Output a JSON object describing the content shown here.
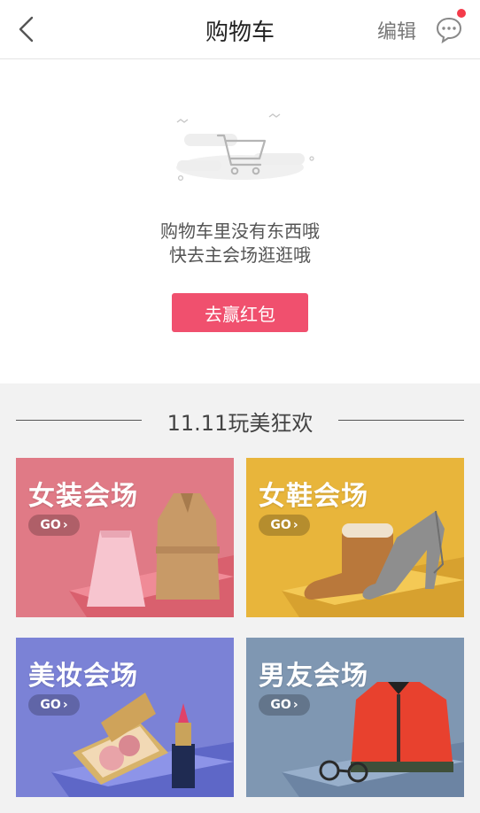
{
  "header": {
    "title": "购物车",
    "edit_label": "编辑"
  },
  "empty_state": {
    "line1": "购物车里没有东西哦",
    "line2": "快去主会场逛逛哦",
    "button_label": "去赢红包"
  },
  "promo": {
    "section_title": "11.11玩美狂欢",
    "tiles": [
      {
        "label": "女装会场",
        "go": "GO"
      },
      {
        "label": "女鞋会场",
        "go": "GO"
      },
      {
        "label": "美妆会场",
        "go": "GO"
      },
      {
        "label": "男友会场",
        "go": "GO"
      }
    ]
  },
  "colors": {
    "accent": "#f0506e",
    "notification_dot": "#f43b4a",
    "tile_women": "#e07a86",
    "tile_shoes": "#e8b53b",
    "tile_beauty": "#7b82d6",
    "tile_men": "#7f97b2"
  },
  "icons": [
    "back-arrow-icon",
    "chat-bubble-icon",
    "empty-cart-icon",
    "chevron-right-icon"
  ]
}
